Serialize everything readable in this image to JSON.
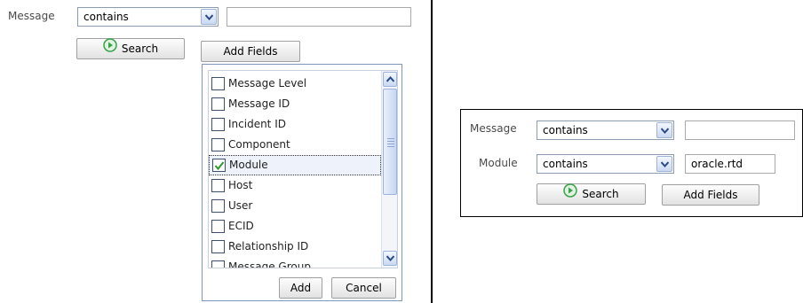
{
  "left_form": {
    "message_label": "Message",
    "operator_value": "contains",
    "search_label": "Search",
    "add_fields_label": "Add Fields"
  },
  "add_fields_popup": {
    "fields": [
      {
        "label": "Message Level",
        "checked": false
      },
      {
        "label": "Message ID",
        "checked": false
      },
      {
        "label": "Incident ID",
        "checked": false
      },
      {
        "label": "Component",
        "checked": false
      },
      {
        "label": "Module",
        "checked": true
      },
      {
        "label": "Host",
        "checked": false
      },
      {
        "label": "User",
        "checked": false
      },
      {
        "label": "ECID",
        "checked": false
      },
      {
        "label": "Relationship ID",
        "checked": false
      },
      {
        "label": "Message Group",
        "checked": false
      }
    ],
    "add_label": "Add",
    "cancel_label": "Cancel"
  },
  "right_form": {
    "message_label": "Message",
    "message_operator": "contains",
    "message_value": "",
    "module_label": "Module",
    "module_operator": "contains",
    "module_value": "oracle.rtd",
    "search_label": "Search",
    "add_fields_label": "Add Fields"
  },
  "colors": {
    "accent_green": "#3aa14a",
    "check_green": "#2e9a2e",
    "border_blue": "#7d96bf"
  },
  "icons": {
    "search_button_icon": "play-circle-icon",
    "dropdown_icon": "chevron-down-icon",
    "check_icon": "checkmark-icon"
  }
}
